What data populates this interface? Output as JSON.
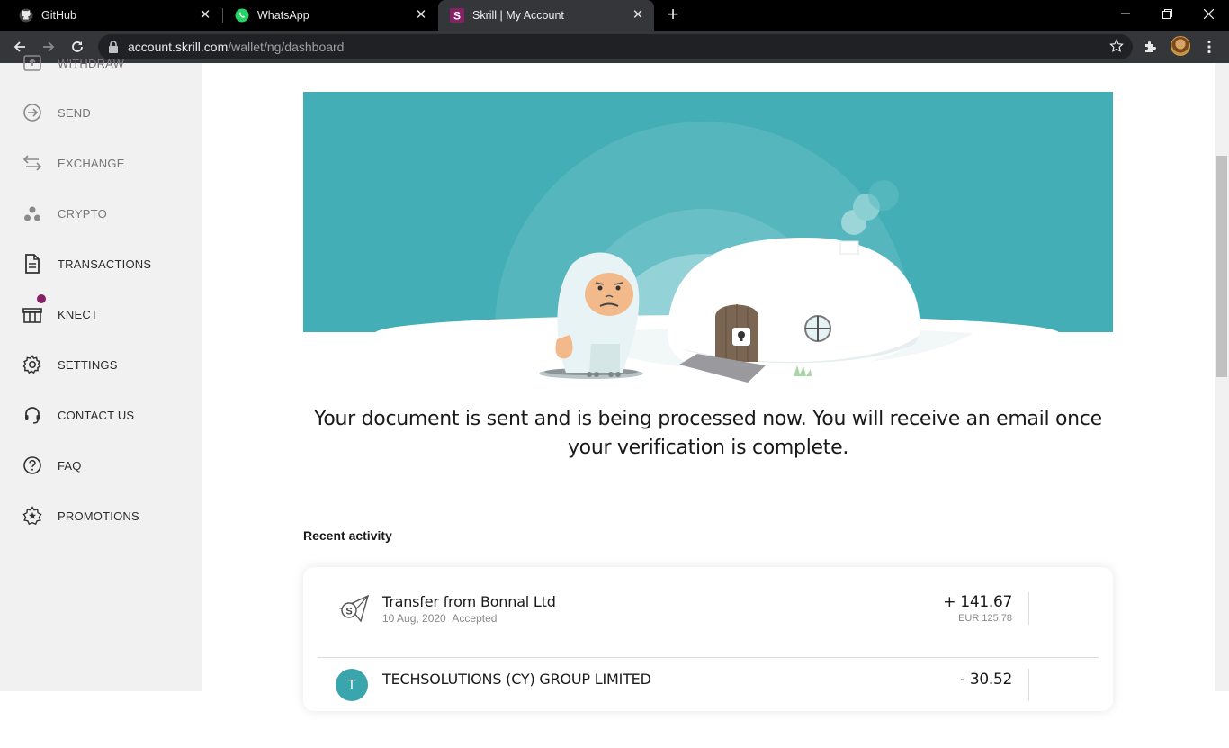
{
  "browser": {
    "tabs": [
      {
        "title": "GitHub",
        "icon": "github-icon"
      },
      {
        "title": "WhatsApp",
        "icon": "whatsapp-icon"
      },
      {
        "title": "Skrill | My Account",
        "icon": "skrill-icon",
        "active": true
      }
    ],
    "url_host": "account.skrill.com",
    "url_path": "/wallet/ng/dashboard"
  },
  "sidebar": {
    "items": [
      {
        "label": "WITHDRAW",
        "icon": "withdraw-icon"
      },
      {
        "label": "SEND",
        "icon": "send-icon"
      },
      {
        "label": "EXCHANGE",
        "icon": "exchange-icon"
      },
      {
        "label": "CRYPTO",
        "icon": "crypto-icon"
      },
      {
        "label": "TRANSACTIONS",
        "icon": "document-icon"
      },
      {
        "label": "KNECT",
        "icon": "gift-icon"
      },
      {
        "label": "SETTINGS",
        "icon": "gear-icon"
      },
      {
        "label": "CONTACT US",
        "icon": "headset-icon"
      },
      {
        "label": "FAQ",
        "icon": "question-icon"
      },
      {
        "label": "PROMOTIONS",
        "icon": "star-badge-icon"
      }
    ]
  },
  "main": {
    "message": "Your document is sent and is being processed now. You will receive an email once your verification is complete.",
    "recent_title": "Recent activity",
    "transactions": [
      {
        "name": "Transfer from Bonnal Ltd",
        "date": "10 Aug, 2020",
        "status": "Accepted",
        "amount": "+ 141.67",
        "sub_amount": "EUR 125.78"
      },
      {
        "name": "TECHSOLUTIONS (CY) GROUP LIMITED",
        "avatar_letter": "T",
        "amount": "- 30.52"
      }
    ]
  },
  "colors": {
    "hero_teal": "#43aeb6",
    "brand_purple": "#862165",
    "avatar_teal": "#3aa5ad"
  }
}
